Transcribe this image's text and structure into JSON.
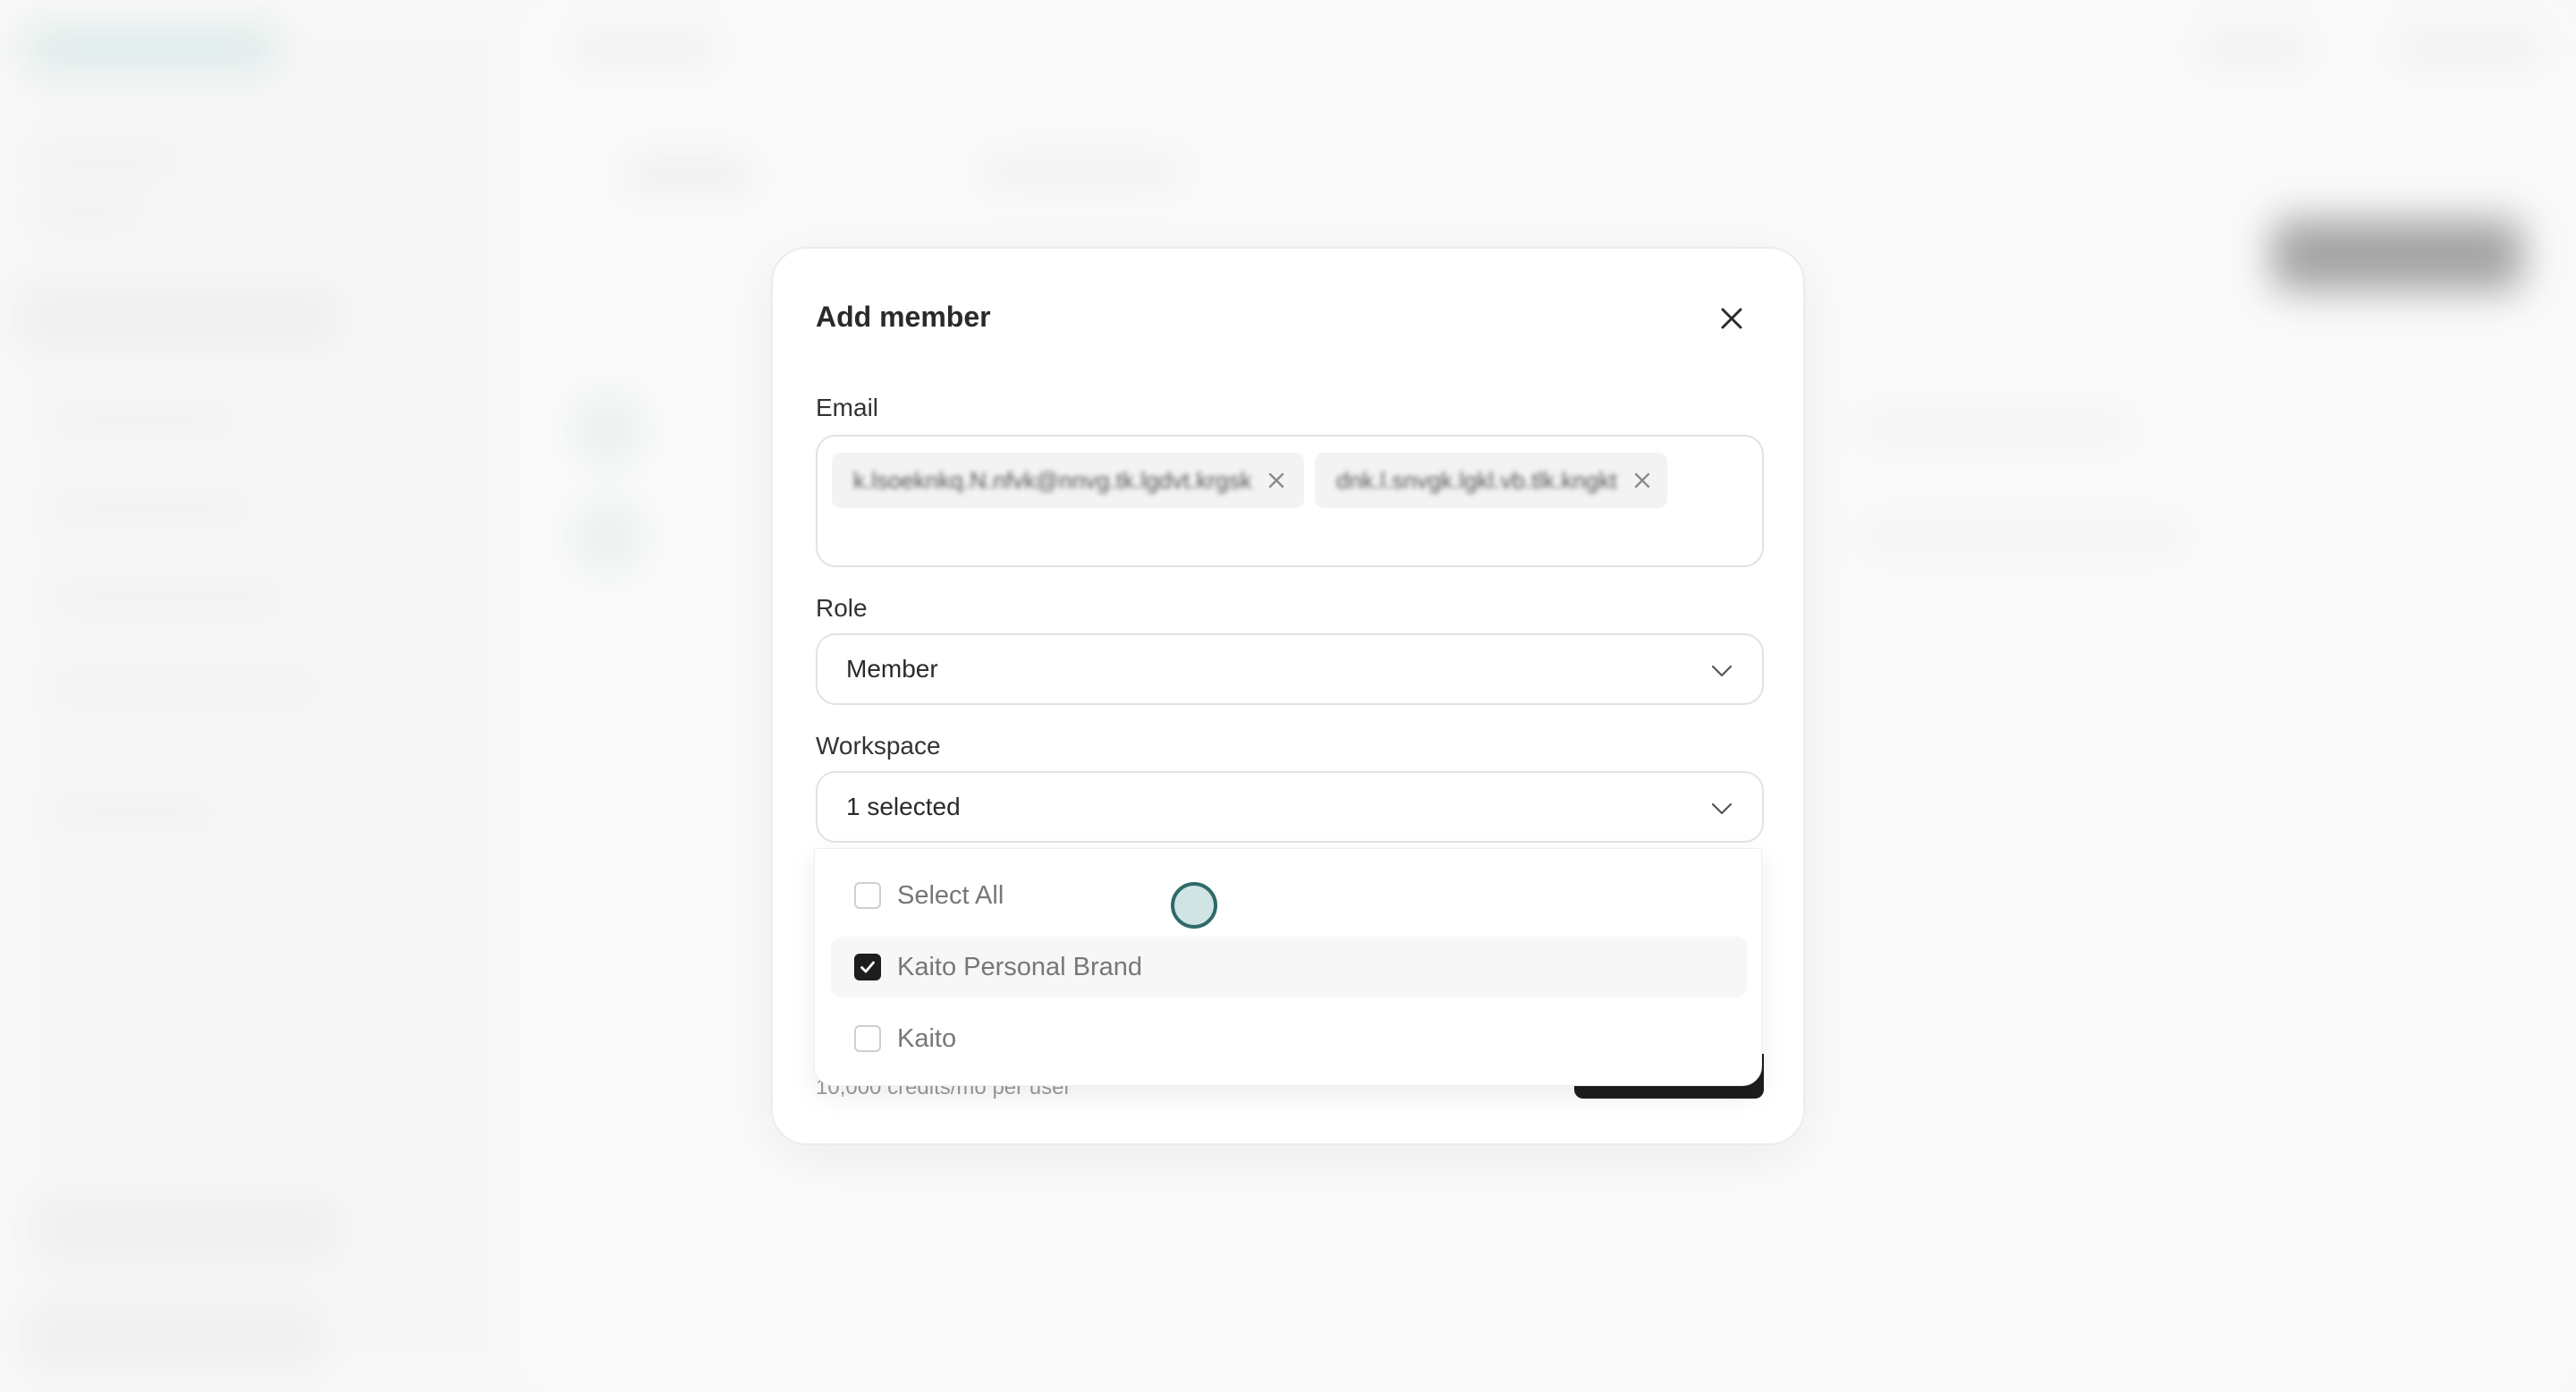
{
  "modal": {
    "title": "Add member",
    "email": {
      "label": "Email",
      "chips": [
        {
          "text": "k.lsoeknkq.N.nfvk@nnvg.tk.lgdvt.krgsk"
        },
        {
          "text": "dnk.l.snvgk.lgkl.vb.tlk.kngkt"
        }
      ]
    },
    "role": {
      "label": "Role",
      "value": "Member"
    },
    "workspace": {
      "label": "Workspace",
      "value": "1 selected",
      "options": [
        {
          "label": "Select All",
          "checked": false
        },
        {
          "label": "Kaito Personal Brand",
          "checked": true
        },
        {
          "label": "Kaito",
          "checked": false
        }
      ]
    },
    "footer_note": "10,000 credits/mo per user"
  },
  "icons": {
    "close": "close-icon",
    "chip_remove": "x-icon",
    "chevron": "chevron-down-icon",
    "check": "check-icon"
  },
  "colors": {
    "accent_dark": "#1d1d1d",
    "cursor_ring": "#2f6a6a"
  }
}
